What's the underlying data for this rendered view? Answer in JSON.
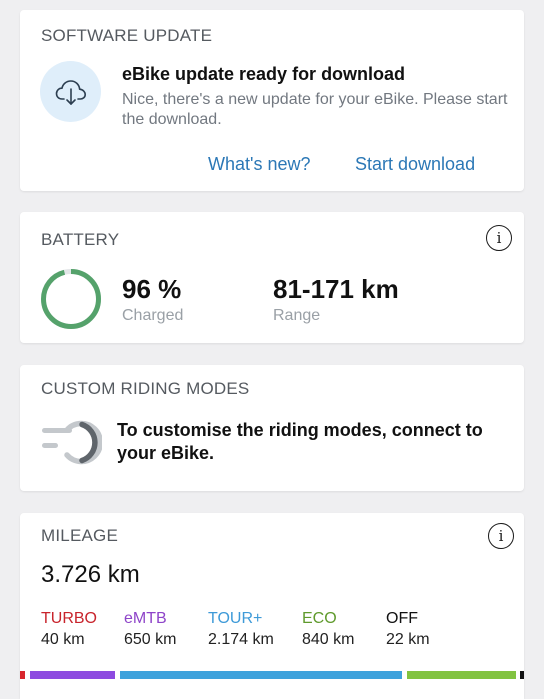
{
  "software_update": {
    "title": "SOFTWARE UPDATE",
    "icon": "cloud-download-icon",
    "heading": "eBike update ready for download",
    "description": "Nice, there's a new update for your eBike. Please start the download.",
    "whats_new_label": "What's new?",
    "start_download_label": "Start download",
    "accent_color": "#2c78b6"
  },
  "battery": {
    "title": "BATTERY",
    "charge_value": "96 %",
    "charge_fraction": 0.96,
    "charge_label": "Charged",
    "range_value": "81-171 km",
    "range_label": "Range",
    "ring_color": "#55a26b",
    "info_icon": "info-icon"
  },
  "custom_riding_modes": {
    "title": "CUSTOM RIDING MODES",
    "icon": "riding-modes-icon",
    "message": "To customise the riding modes, connect to your eBike."
  },
  "mileage": {
    "title": "MILEAGE",
    "total": "3.726 km",
    "info_icon": "info-icon",
    "modes": [
      {
        "name": "TURBO",
        "km": "40 km",
        "color": "#c8242c"
      },
      {
        "name": "eMTB",
        "km": "650 km",
        "color": "#8e44c9"
      },
      {
        "name": "TOUR+",
        "km": "2.174 km",
        "color": "#3e9ad8"
      },
      {
        "name": "ECO",
        "km": "840 km",
        "color": "#5f9a2c"
      },
      {
        "name": "OFF",
        "km": "22 km",
        "color": "#111111"
      }
    ],
    "bar_colors": [
      "#d8262d",
      "#8d4ae0",
      "#3ea2dc",
      "#82c341",
      "#111111"
    ]
  }
}
